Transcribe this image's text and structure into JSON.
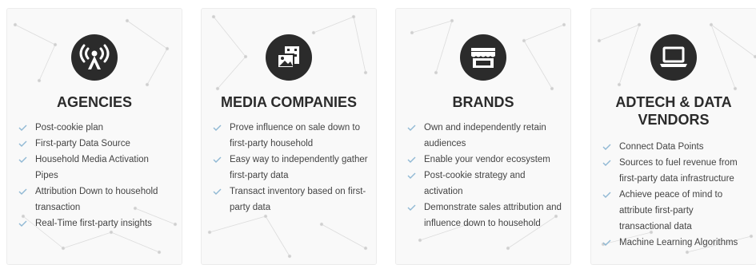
{
  "colors": {
    "icon_bg": "#2b2b2b",
    "check": "#8fb8d4",
    "text": "#444444",
    "title": "#2b2b2b"
  },
  "cards": [
    {
      "title": "AGENCIES",
      "icon": "broadcast-tower-icon",
      "items": [
        "Post-cookie plan",
        "First-party Data Source",
        "Household Media Activation Pipes",
        "Attribution Down to household transaction",
        "Real-Time first-party insights"
      ]
    },
    {
      "title": "MEDIA COMPANIES",
      "icon": "media-photo-film-icon",
      "items": [
        "Prove influence on sale down to first-party household",
        "Easy way to independently gather first-party data",
        "Transact inventory based on first-party data"
      ]
    },
    {
      "title": "BRANDS",
      "icon": "storefront-icon",
      "items": [
        "Own and independently retain audiences",
        "Enable your vendor ecosystem",
        "Post-cookie strategy and activation",
        "Demonstrate sales attribution and influence down to household"
      ]
    },
    {
      "title": "ADTECH & DATA VENDORS",
      "icon": "laptop-icon",
      "items": [
        "Connect Data Points",
        "Sources to fuel revenue from first-party data infrastructure",
        "Achieve peace of mind to attribute first-party transactional data",
        "Machine Learning Algorithms"
      ]
    }
  ]
}
